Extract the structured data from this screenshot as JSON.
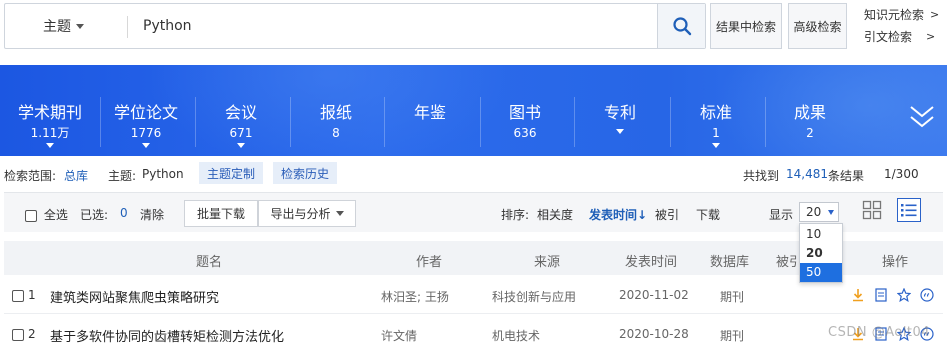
{
  "search": {
    "field": "主题",
    "query": "Python",
    "within_results_label": "结果中检索",
    "advanced_label": "高级检索",
    "knowledge_search": "知识元检索",
    "citation_search": "引文检索",
    "link_arrow": ">"
  },
  "databases": [
    {
      "name": "学术期刊",
      "count": "1.11万"
    },
    {
      "name": "学位论文",
      "count": "1776"
    },
    {
      "name": "会议",
      "count": "671"
    },
    {
      "name": "报纸",
      "count": "8"
    },
    {
      "name": "年鉴",
      "count": ""
    },
    {
      "name": "图书",
      "count": "636"
    },
    {
      "name": "专利",
      "count": ""
    },
    {
      "name": "标准",
      "count": "1"
    },
    {
      "name": "成果",
      "count": "2"
    }
  ],
  "scope": {
    "label": "检索范围:",
    "value": "总库",
    "topic_label": "主题:",
    "topic_value": "Python",
    "custom_topic": "主题定制",
    "history": "检索历史",
    "found_prefix": "共找到",
    "found_count": "14,481",
    "found_suffix": "条结果",
    "page": "1/300"
  },
  "toolbar": {
    "select_all": "全选",
    "selected_label": "已选:",
    "selected_count": "0",
    "clear": "清除",
    "batch_download": "批量下载",
    "export_analyze": "导出与分析",
    "sort_label": "排序:",
    "sort_relevance": "相关度",
    "sort_date": "发表时间",
    "sort_cited": "被引",
    "sort_download": "下载",
    "display_label": "显示",
    "display_value": "20"
  },
  "page_size_options": [
    "10",
    "20",
    "50"
  ],
  "table": {
    "headers": [
      "题名",
      "作者",
      "来源",
      "发表时间",
      "数据库",
      "被引",
      "操作"
    ],
    "rows": [
      {
        "index": "1",
        "title": "建筑类网站聚焦爬虫策略研究",
        "authors": "林汨圣; 王扬",
        "source": "科技创新与应用",
        "date": "2020-11-02",
        "db": "期刊"
      },
      {
        "index": "2",
        "title": "基于多软件协同的齿槽转矩检测方法优化",
        "authors": "许文倩",
        "source": "机电技术",
        "date": "2020-10-28",
        "db": "期刊"
      }
    ]
  },
  "watermark": "CSDN @Aolt04",
  "colors": {
    "band": "#2766e6",
    "accent": "#1f5fb8",
    "selected_option": "#1e6fe0",
    "download_icon": "#f0a020"
  }
}
